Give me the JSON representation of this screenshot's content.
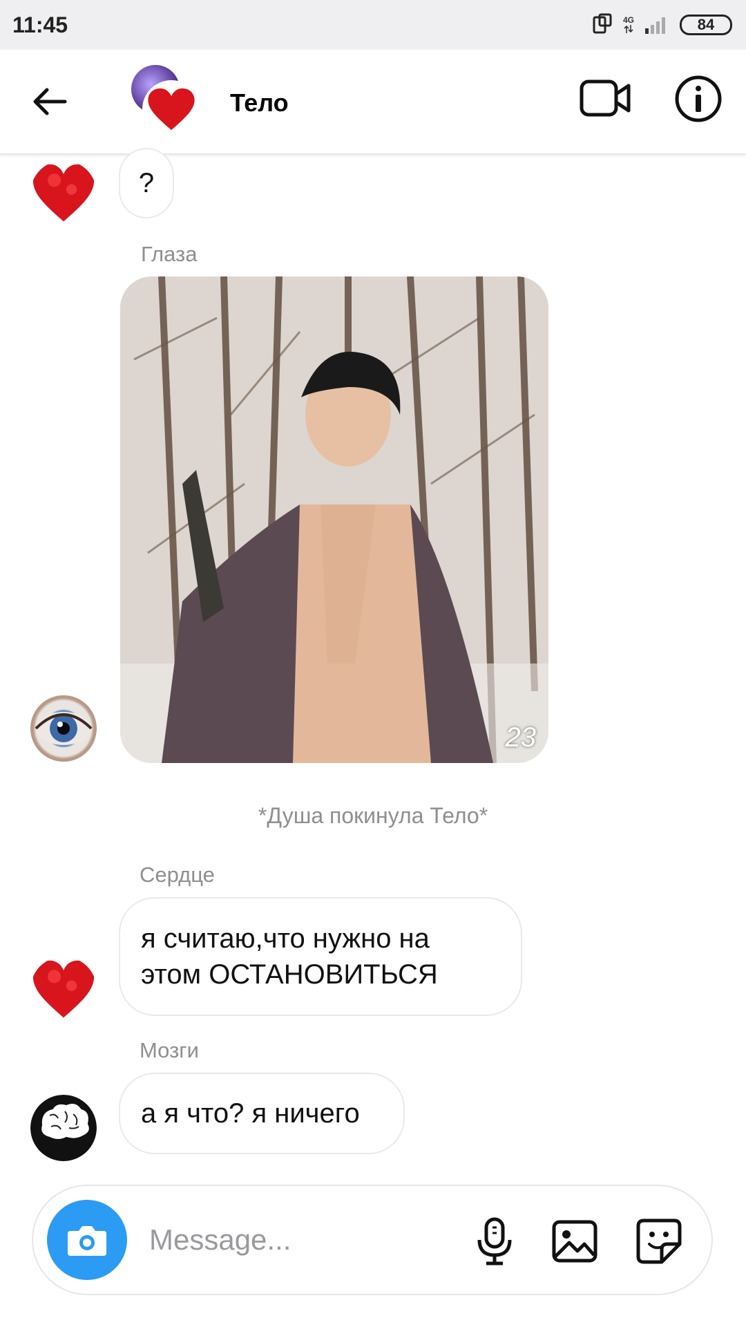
{
  "status_bar": {
    "time": "11:45",
    "network": "4G",
    "battery": "84"
  },
  "header": {
    "title": "Тело"
  },
  "messages": {
    "heart_question": "?",
    "eyes_sender": "Глаза",
    "photo_count": "23",
    "system": "*Душа покинула Тело*",
    "heart_sender": "Сердце",
    "heart_text_line1": "я считаю,что нужно на",
    "heart_text_line2": "этом ОСТАНОВИТЬСЯ",
    "brain_sender": "Мозги",
    "brain_text": "а я что? я ничего"
  },
  "composer": {
    "placeholder": "Message..."
  },
  "colors": {
    "accent": "#2b9bf3",
    "heart": "#d8141c",
    "muted_text": "#8e8e93",
    "bubble_border": "#e9e9ec"
  },
  "icons": {
    "back": "arrow-left-icon",
    "video": "video-camera-icon",
    "info": "info-icon",
    "camera": "camera-icon",
    "mic": "microphone-icon",
    "gallery": "image-icon",
    "sticker": "sticker-icon"
  }
}
